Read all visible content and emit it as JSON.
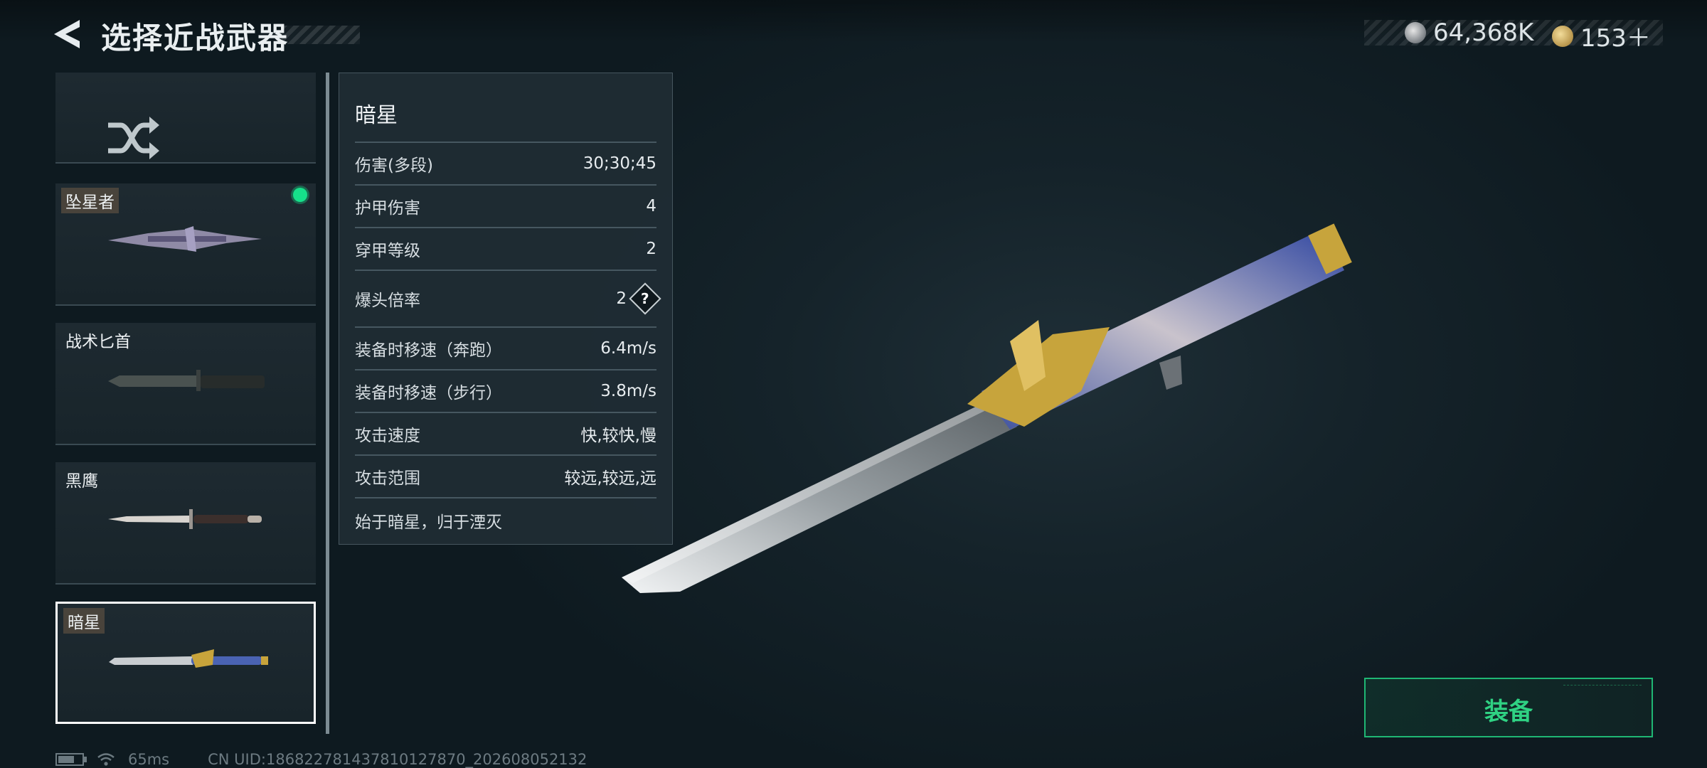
{
  "header": {
    "title": "选择近战武器",
    "back_icon": "back-arrow-icon"
  },
  "currencies": [
    {
      "icon": "silver-coin-icon",
      "value": "64,368K"
    },
    {
      "icon": "gold-coin-icon",
      "value": "153＋"
    }
  ],
  "weapons": [
    {
      "name": "坠星者",
      "equipped": true,
      "selected": false
    },
    {
      "name": "战术匕首",
      "equipped": false,
      "selected": false
    },
    {
      "name": "黑鹰",
      "equipped": false,
      "selected": false
    },
    {
      "name": "暗星",
      "equipped": false,
      "selected": true
    }
  ],
  "random_button_icon": "shuffle-icon",
  "stats": {
    "title": "暗星",
    "rows": [
      {
        "label": "伤害(多段)",
        "value": "30;30;45"
      },
      {
        "label": "护甲伤害",
        "value": "4"
      },
      {
        "label": "穿甲等级",
        "value": "2"
      },
      {
        "label": "爆头倍率",
        "value": "2"
      },
      {
        "label": "装备时移速（奔跑）",
        "value": "6.4m/s"
      },
      {
        "label": "装备时移速（步行）",
        "value": "3.8m/s"
      },
      {
        "label": "攻击速度",
        "value": "快,较快,慢"
      },
      {
        "label": "攻击范围",
        "value": "较远,较远,远"
      }
    ],
    "description": "始于暗星，归于湮灭",
    "help_icon": "?"
  },
  "equip_button": {
    "label": "装备"
  },
  "footer": {
    "ping": "65ms",
    "uid": "CN UID:1868227814378101278​70_202608052132"
  },
  "colors": {
    "accent_green": "#2fd283",
    "equipped_dot": "#16e08a",
    "background": "#15232a"
  }
}
